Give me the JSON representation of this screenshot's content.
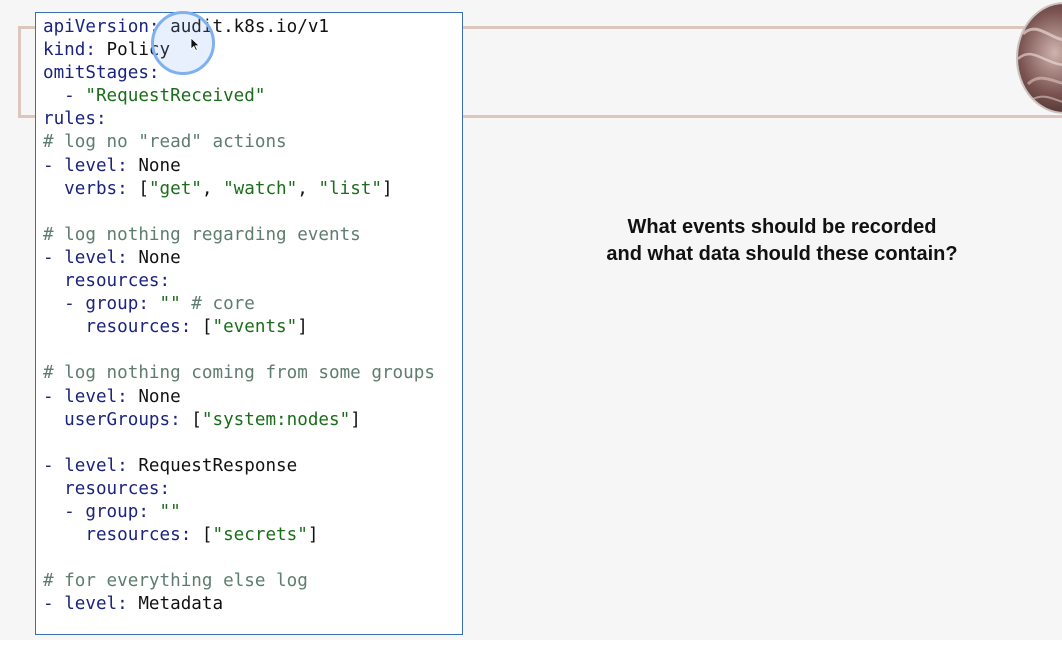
{
  "slide": {
    "question_lines": [
      "What events should be recorded",
      "and what data should these contain?"
    ]
  },
  "code_lines": [
    [
      {
        "t": "apiVersion:",
        "c": "k"
      },
      {
        "t": " audit.k8s.io/v1",
        "c": "p"
      }
    ],
    [
      {
        "t": "kind:",
        "c": "k"
      },
      {
        "t": " Policy",
        "c": "p"
      }
    ],
    [
      {
        "t": "omitStages:",
        "c": "k"
      }
    ],
    [
      {
        "t": "  - ",
        "c": "d"
      },
      {
        "t": "\"RequestReceived\"",
        "c": "s"
      }
    ],
    [
      {
        "t": "rules:",
        "c": "k"
      }
    ],
    [
      {
        "t": "# log no \"read\" actions",
        "c": "c"
      }
    ],
    [
      {
        "t": "- ",
        "c": "d"
      },
      {
        "t": "level:",
        "c": "k"
      },
      {
        "t": " None",
        "c": "p"
      }
    ],
    [
      {
        "t": "  verbs:",
        "c": "k"
      },
      {
        "t": " [",
        "c": "p"
      },
      {
        "t": "\"get\"",
        "c": "s"
      },
      {
        "t": ", ",
        "c": "p"
      },
      {
        "t": "\"watch\"",
        "c": "s"
      },
      {
        "t": ", ",
        "c": "p"
      },
      {
        "t": "\"list\"",
        "c": "s"
      },
      {
        "t": "]",
        "c": "p"
      }
    ],
    [],
    [
      {
        "t": "# log nothing regarding events",
        "c": "c"
      }
    ],
    [
      {
        "t": "- ",
        "c": "d"
      },
      {
        "t": "level:",
        "c": "k"
      },
      {
        "t": " None",
        "c": "p"
      }
    ],
    [
      {
        "t": "  resources:",
        "c": "k"
      }
    ],
    [
      {
        "t": "  - ",
        "c": "d"
      },
      {
        "t": "group:",
        "c": "k"
      },
      {
        "t": " ",
        "c": "p"
      },
      {
        "t": "\"\"",
        "c": "s"
      },
      {
        "t": " # core",
        "c": "c"
      }
    ],
    [
      {
        "t": "    resources:",
        "c": "k"
      },
      {
        "t": " [",
        "c": "p"
      },
      {
        "t": "\"events\"",
        "c": "s"
      },
      {
        "t": "]",
        "c": "p"
      }
    ],
    [],
    [
      {
        "t": "# log nothing coming from some groups",
        "c": "c"
      }
    ],
    [
      {
        "t": "- ",
        "c": "d"
      },
      {
        "t": "level:",
        "c": "k"
      },
      {
        "t": " None",
        "c": "p"
      }
    ],
    [
      {
        "t": "  userGroups:",
        "c": "k"
      },
      {
        "t": " [",
        "c": "p"
      },
      {
        "t": "\"system:nodes\"",
        "c": "s"
      },
      {
        "t": "]",
        "c": "p"
      }
    ],
    [],
    [
      {
        "t": "- ",
        "c": "d"
      },
      {
        "t": "level:",
        "c": "k"
      },
      {
        "t": " RequestResponse",
        "c": "p"
      }
    ],
    [
      {
        "t": "  resources:",
        "c": "k"
      }
    ],
    [
      {
        "t": "  - ",
        "c": "d"
      },
      {
        "t": "group:",
        "c": "k"
      },
      {
        "t": " ",
        "c": "p"
      },
      {
        "t": "\"\"",
        "c": "s"
      }
    ],
    [
      {
        "t": "    resources:",
        "c": "k"
      },
      {
        "t": " [",
        "c": "p"
      },
      {
        "t": "\"secrets\"",
        "c": "s"
      },
      {
        "t": "]",
        "c": "p"
      }
    ],
    [],
    [
      {
        "t": "# for everything else log",
        "c": "c"
      }
    ],
    [
      {
        "t": "- ",
        "c": "d"
      },
      {
        "t": "level:",
        "c": "k"
      },
      {
        "t": " Metadata",
        "c": "p"
      }
    ]
  ],
  "colors": {
    "keyword": "#1a237e",
    "string": "#1b6d1b",
    "comment": "#5e7d6f",
    "panel_border": "#3a6fb0",
    "frame_accent": "#dcc6bd"
  },
  "icons": {
    "cursor": "cursor-arrow-icon",
    "avatar": "presenter-avatar"
  }
}
